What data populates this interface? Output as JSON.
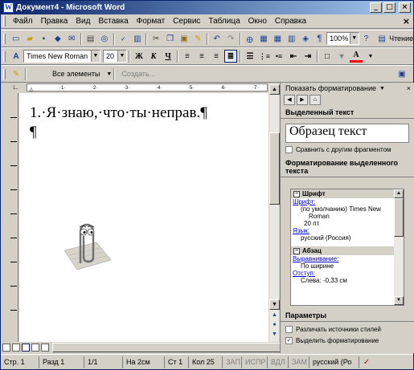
{
  "window": {
    "title": "Документ4 - Microsoft Word"
  },
  "menu": [
    {
      "label": "Файл",
      "key": "Ф"
    },
    {
      "label": "Правка",
      "key": "П"
    },
    {
      "label": "Вид",
      "key": "В"
    },
    {
      "label": "Вставка",
      "key": "а"
    },
    {
      "label": "Формат",
      "key": "о"
    },
    {
      "label": "Сервис",
      "key": "С"
    },
    {
      "label": "Таблица",
      "key": "Т"
    },
    {
      "label": "Окно",
      "key": "О"
    },
    {
      "label": "Справка",
      "key": "С"
    }
  ],
  "standard_toolbar": {
    "zoom": "100%",
    "read_label": "Чтение"
  },
  "formatting_toolbar": {
    "font": "Times New Roman",
    "size": "20",
    "bold": "Ж",
    "italic": "К",
    "underline": "Ч"
  },
  "styles_toolbar": {
    "style": "Все элементы",
    "create": "Создать..."
  },
  "document": {
    "line1": "1.·Я·знаю,·что·ты·неправ.¶",
    "line2": "¶"
  },
  "task_pane": {
    "title": "Показать форматирование",
    "selected_header": "Выделенный текст",
    "sample": "Образец текст",
    "compare_label": "Сравнить с другим фрагментом",
    "formatting_header": "Форматирование выделенного текста",
    "font_section": "Шрифт",
    "font_link": "Шрифт:",
    "font_value1": "(по умолчанию) Times New",
    "font_value2": "Roman",
    "font_size": "20 пт",
    "lang_link": "Язык:",
    "lang_value": "русский (Россия)",
    "para_section": "Абзац",
    "align_link": "Выравнивание:",
    "align_value": "По ширине",
    "indent_link": "Отступ:",
    "indent_value": "Слева: -0,33 см",
    "params_header": "Параметры",
    "opt1": "Различать источники стилей",
    "opt2": "Выделить форматирование"
  },
  "status": {
    "page": "Стр. 1",
    "section": "Разд 1",
    "pages": "1/1",
    "at": "На 2см",
    "line": "Ст 1",
    "col": "Кол 25",
    "rec": "ЗАП",
    "trk": "ИСПР",
    "ext": "ВДЛ",
    "ovr": "ЗАМ",
    "lang": "русский (Ро"
  },
  "colors": {
    "title_start": "#0a246a",
    "title_end": "#a6caf0",
    "link": "#0000cc",
    "font_color_bar": "#ff0000"
  }
}
